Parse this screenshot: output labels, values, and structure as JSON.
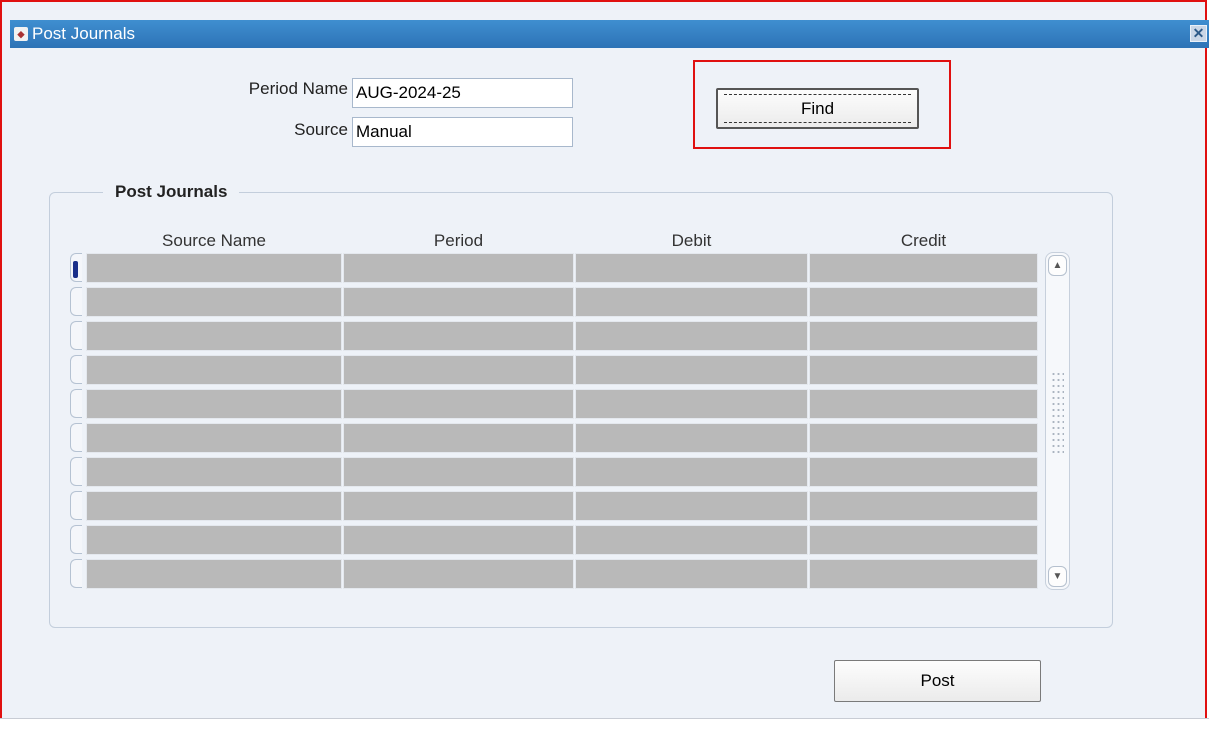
{
  "window": {
    "title": "Post Journals",
    "close_glyph": "✕",
    "title_icon": "oracle-forms-window-icon"
  },
  "form": {
    "period_name_label": "Period Name",
    "period_name_value": "AUG-2024-25",
    "source_label": "Source",
    "source_value": "Manual"
  },
  "buttons": {
    "find_label": "Find",
    "post_label": "Post"
  },
  "group": {
    "title": "Post Journals",
    "columns": [
      "Source Name",
      "Period",
      "Debit",
      "Credit"
    ],
    "rows": [
      [
        "",
        "",
        "",
        ""
      ],
      [
        "",
        "",
        "",
        ""
      ],
      [
        "",
        "",
        "",
        ""
      ],
      [
        "",
        "",
        "",
        ""
      ],
      [
        "",
        "",
        "",
        ""
      ],
      [
        "",
        "",
        "",
        ""
      ],
      [
        "",
        "",
        "",
        ""
      ],
      [
        "",
        "",
        "",
        ""
      ],
      [
        "",
        "",
        "",
        ""
      ],
      [
        "",
        "",
        "",
        ""
      ]
    ],
    "active_row": 0
  },
  "scrollbar": {
    "up_glyph": "▲",
    "down_glyph": "▼"
  },
  "colors": {
    "titlebar": "#2d73b6",
    "highlight": "#e01010",
    "cell_fill": "#b9b9b9",
    "window_bg": "#eef2f8"
  }
}
